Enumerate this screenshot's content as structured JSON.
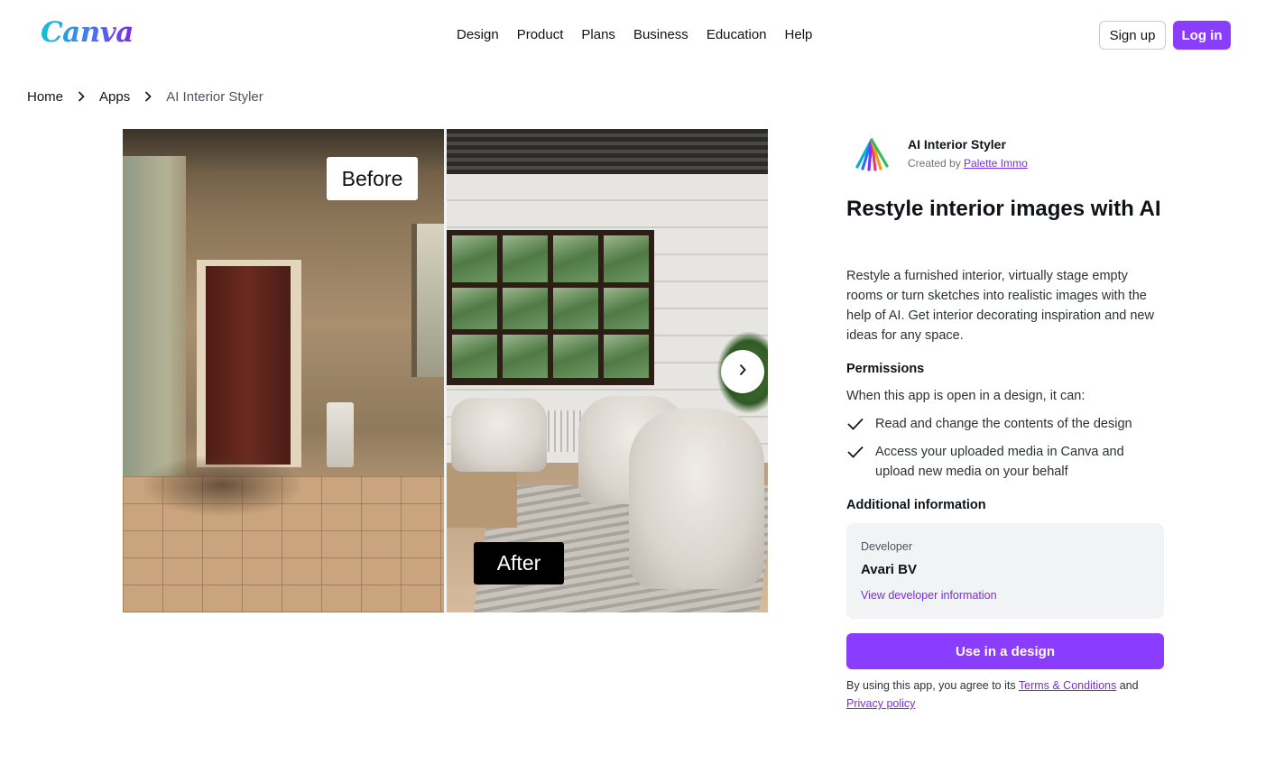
{
  "brand": {
    "logo_text": "Canva",
    "accent": "#8b3dff",
    "link_color": "#7d2ae8"
  },
  "nav": {
    "items": [
      {
        "label": "Design"
      },
      {
        "label": "Product"
      },
      {
        "label": "Plans"
      },
      {
        "label": "Business"
      },
      {
        "label": "Education"
      },
      {
        "label": "Help"
      }
    ],
    "signup_label": "Sign up",
    "login_label": "Log in"
  },
  "breadcrumb": {
    "items": [
      {
        "label": "Home"
      },
      {
        "label": "Apps"
      },
      {
        "label": "AI Interior Styler"
      }
    ],
    "separator_icon": "chevron-right-icon"
  },
  "hero": {
    "before_label": "Before",
    "after_label": "After",
    "next_icon": "chevron-right-icon"
  },
  "app": {
    "name": "AI Interior Styler",
    "created_by_prefix": "Created by",
    "creator": "Palette Immo",
    "title": "Restyle interior images with AI",
    "description": "Restyle a furnished interior, virtually stage empty rooms or turn sketches into realistic images with the help of AI. Get interior decorating inspiration and new ideas for any space."
  },
  "permissions": {
    "heading": "Permissions",
    "intro": "When this app is open in a design, it can:",
    "items": [
      {
        "text": "Read and change the contents of the design",
        "icon": "check-icon"
      },
      {
        "text": "Access your uploaded media in Canva and upload new media on your behalf",
        "icon": "check-icon"
      }
    ]
  },
  "additional_info": {
    "heading": "Additional information",
    "developer_label": "Developer",
    "developer_name": "Avari BV",
    "developer_link": "View developer information"
  },
  "cta": {
    "use_label": "Use in a design"
  },
  "legal": {
    "prefix": "By using this app, you agree to its",
    "terms": "Terms & Conditions",
    "and": "and",
    "privacy": "Privacy policy"
  }
}
